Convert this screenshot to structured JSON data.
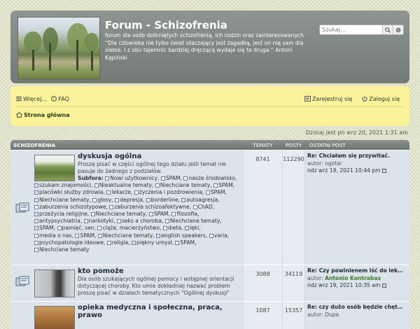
{
  "header": {
    "title": "Forum - Schizofrenia",
    "description": "forum dla osób dotkniętych schizofrenią, ich rodzin oraz zainteresowanych ''Dla człowieka nie tylko świat otaczający jest zagadką, jest on nią sam dla siebie. I z obu tajemnic bardziej dręczącą wydaje się ta druga.'' Antoni Kępiński",
    "search_placeholder": "Szukaj…"
  },
  "nav": {
    "more": "Więcej…",
    "faq": "FAQ",
    "register": "Zarejestruj się",
    "login": "Zaloguj się",
    "home": "Strona główna"
  },
  "date_text": "Dzisiaj jest pn wrz 20, 2021 1:31 am",
  "table": {
    "category": "SCHIZOFRENIA",
    "col_topics": "TEMATY",
    "col_posts": "POSTY",
    "col_last": "OSTATNI POST"
  },
  "forums": [
    {
      "title": "dyskusja ogólna",
      "description": "Proszę pisać w części ogólnej tego działu jeśli temat nie pasuje do żadnego z podziałów.",
      "subforums_label": "Subfora:",
      "subforums": [
        "Nowi użytkownicy,",
        "SPAM,",
        "nasze środowisko,",
        "szukam znajomości,",
        "Nieaktualne tematy,",
        "Niechciane tematy,",
        "SPAM,",
        "placówki służby zdrowia,",
        "lekarze,",
        "życzenia i pozdrowienia,",
        "SPAM,",
        "Niechciane tematy,",
        "głosy,",
        "depresja,",
        "borderline,",
        "autoagresja,",
        "zaburzenia schizotypowe,",
        "zaburzenia schizoafektywne,",
        "ChAD,",
        "przeżycia religijne,",
        "Niechciane tematy,",
        "SPAM,",
        "filozofia,",
        "antypsychiatria,",
        "narkotyki,",
        "seks a choroba,",
        "Niechciane tematy,",
        "SPAM,",
        "pamięć, sen,",
        "ciąża, macierzyństwo,",
        "dieta,",
        "lęki,",
        "media o nas,",
        "SPAM,",
        "Niechciane tematy,",
        "english speakers,",
        "varia,",
        "psychopatologie ideowe,",
        "religia,",
        "piękny umysł,",
        "SPAM,",
        "Niechciane tematy"
      ],
      "topics": "8741",
      "posts": "112290",
      "last_title": "Re: Chciałam się przywitać.",
      "last_author_label": "autor:",
      "last_author": "ogotai",
      "last_date": "ndz wrz 19, 2021 10:44 pm"
    },
    {
      "title": "kto pomoże",
      "description": "Dla osób szukających ogólnej pomocy i wstępnej orientacji dotyczącej choroby. Kto umie dokładniej nazwać problem proszę pisać w działach tematycznych \"Ogólnej dyskusji\"",
      "topics": "3088",
      "posts": "34119",
      "last_title": "Re: Czy powinienem iść do lek…",
      "last_author_label": "autor:",
      "last_author": "Antonio Kontrabas",
      "last_date": "ndz wrz 19, 2021 10:35 am"
    },
    {
      "title": "opieka medyczna i społeczna, praca, prawo",
      "topics": "1087",
      "posts": "15357",
      "last_title": "Re: czy dużo osób będzie chęt…",
      "last_author_label": "autor:",
      "last_author": "Dupa"
    }
  ],
  "colors": {
    "navbar": "#faf39a",
    "header": "#7f8582",
    "accent_green": "#3a7a2a"
  }
}
